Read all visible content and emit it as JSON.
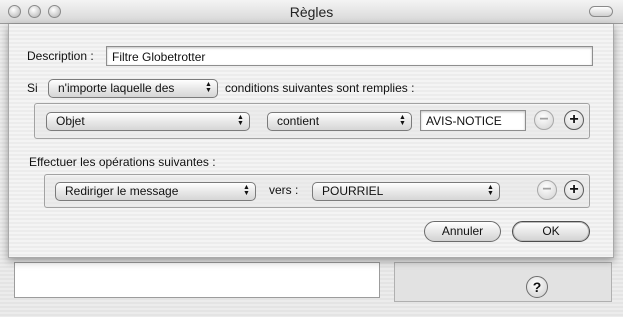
{
  "window": {
    "title": "Règles"
  },
  "sheet": {
    "description_label": "Description :",
    "description_value": "Filtre Globetrotter",
    "si_label": "Si",
    "match_popup": "n'importe laquelle des",
    "conditions_label": "conditions suivantes sont remplies :",
    "condition": {
      "field_popup": "Objet",
      "operator_popup": "contient",
      "value": "AVIS-NOTICE"
    },
    "actions_label": "Effectuer les opérations suivantes :",
    "action": {
      "action_popup": "Rediriger le message",
      "vers_label": "vers :",
      "target_popup": "POURRIEL"
    },
    "cancel_label": "Annuler",
    "ok_label": "OK"
  },
  "parent": {
    "help_label": "?"
  },
  "icons": {
    "minus": "−",
    "plus": "+",
    "popup_arrows": "▲▼"
  }
}
